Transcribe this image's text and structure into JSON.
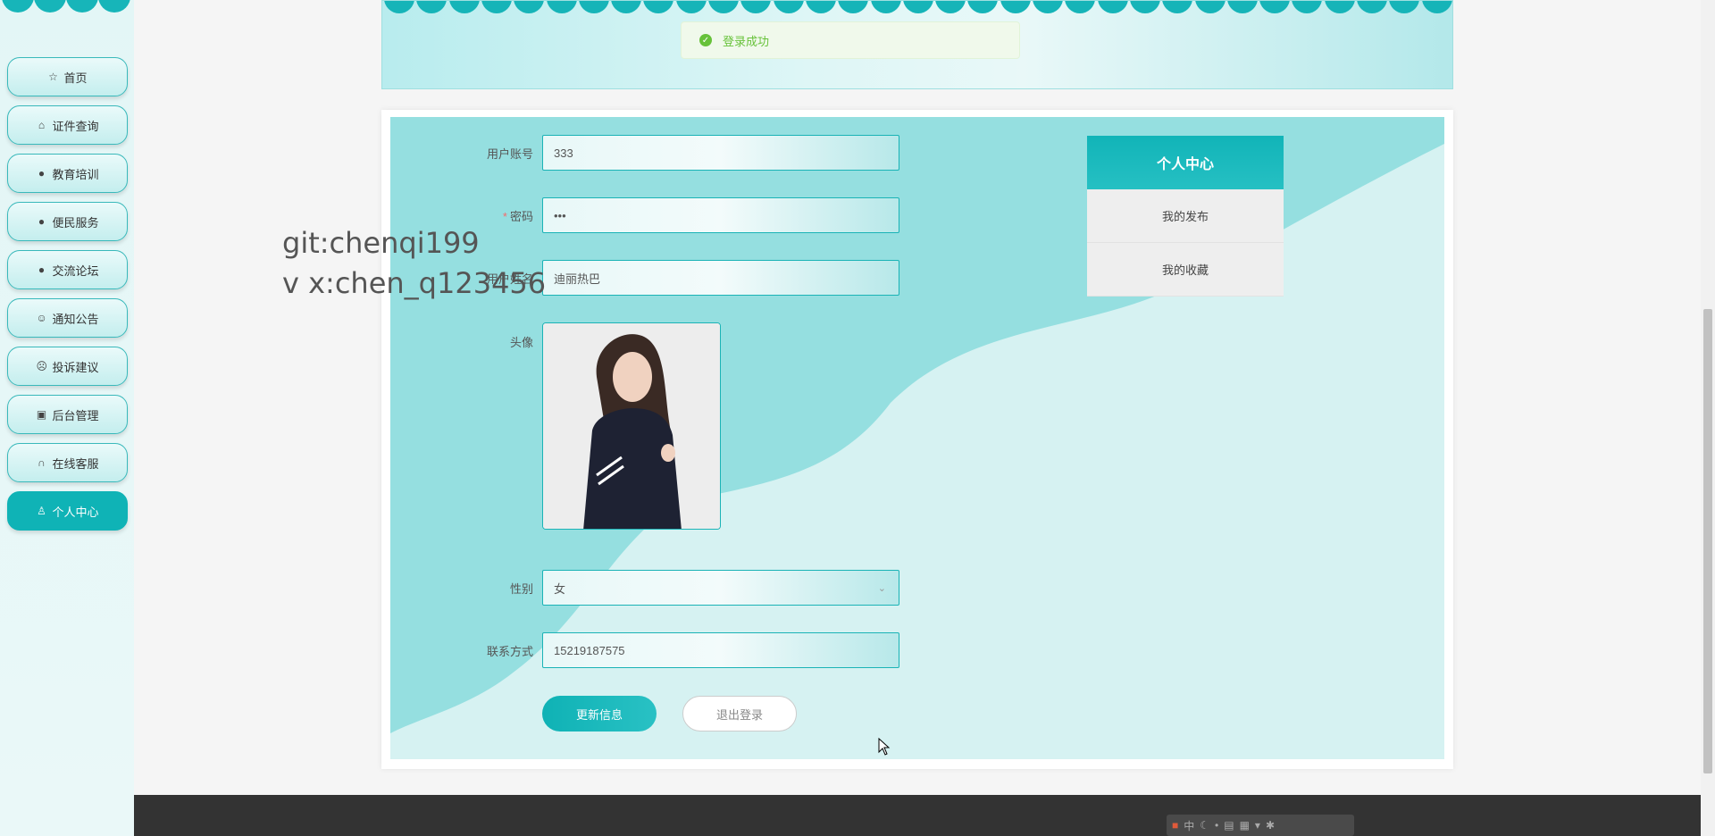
{
  "nav": {
    "items": [
      {
        "label": "首页",
        "icon": "star-icon",
        "glyph": "☆"
      },
      {
        "label": "证件查询",
        "icon": "bag-icon",
        "glyph": "⌂"
      },
      {
        "label": "教育培训",
        "icon": "alert-circle-icon",
        "glyph": "●"
      },
      {
        "label": "便民服务",
        "icon": "question-circle-icon",
        "glyph": "●"
      },
      {
        "label": "交流论坛",
        "icon": "info-circle-icon",
        "glyph": "●"
      },
      {
        "label": "通知公告",
        "icon": "smile-icon",
        "glyph": "☺"
      },
      {
        "label": "投诉建议",
        "icon": "face-icon",
        "glyph": "☹"
      },
      {
        "label": "后台管理",
        "icon": "box-icon",
        "glyph": "▣"
      },
      {
        "label": "在线客服",
        "icon": "headset-icon",
        "glyph": "∩"
      },
      {
        "label": "个人中心",
        "icon": "user-icon",
        "glyph": "♙"
      }
    ],
    "active_index": 9
  },
  "toast": {
    "message": "登录成功",
    "icon": "check-circle-icon"
  },
  "form": {
    "username": {
      "label": "用户账号",
      "value": "333"
    },
    "password": {
      "label": "密码",
      "value": "•••",
      "required_mark": "*"
    },
    "realname": {
      "label": "用户姓名",
      "value": "迪丽热巴"
    },
    "avatar": {
      "label": "头像"
    },
    "gender": {
      "label": "性别",
      "value": "女"
    },
    "phone": {
      "label": "联系方式",
      "value": "15219187575"
    },
    "update_button": "更新信息",
    "logout_button": "退出登录"
  },
  "side_menu": {
    "title": "个人中心",
    "items": [
      "我的发布",
      "我的收藏"
    ]
  },
  "watermark": {
    "line1": "git:chenqi199",
    "line2": "v x:chen_q123456"
  },
  "ime_toolbar": {
    "lang": "中"
  },
  "colors": {
    "accent": "#0fb3b6",
    "success": "#67c23a",
    "footer": "#333333"
  }
}
